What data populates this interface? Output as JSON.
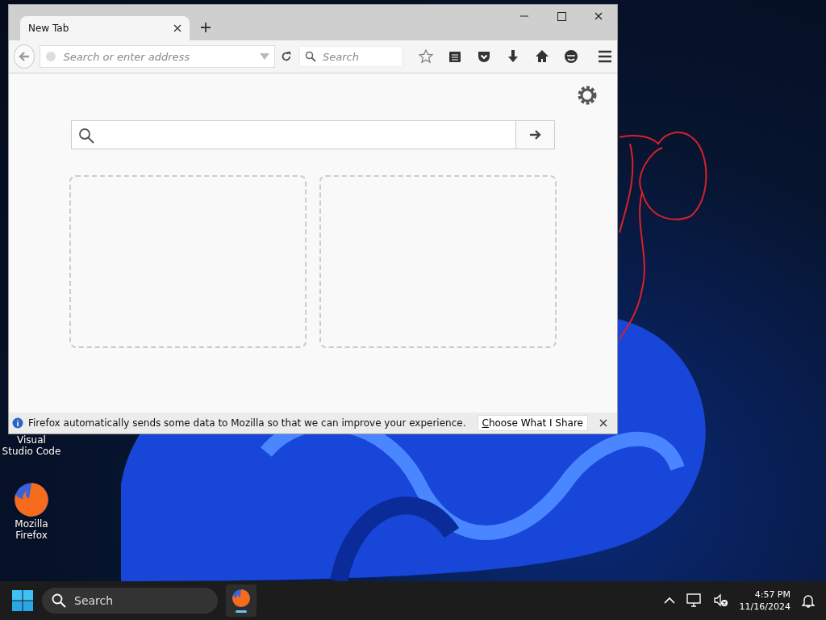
{
  "browser": {
    "tabs": [
      {
        "label": "New Tab",
        "selected": true
      }
    ],
    "address_bar": {
      "placeholder": "Search or enter address"
    },
    "search_bar": {
      "placeholder": "Search"
    },
    "page": {
      "tiles": [
        {
          "kind": "placeholder"
        },
        {
          "kind": "placeholder"
        }
      ]
    },
    "notification": {
      "message": "Firefox automatically sends some data to Mozilla so that we can improve your experience.",
      "button": "Choose What I Share"
    }
  },
  "desktop_icons": [
    {
      "label": "Visual Studio Code",
      "kind": "vscode"
    },
    {
      "label": "Mozilla Firefox",
      "kind": "firefox"
    }
  ],
  "taskbar": {
    "search": {
      "placeholder": "Search"
    },
    "time": "4:57 PM",
    "date": "11/16/2024"
  }
}
